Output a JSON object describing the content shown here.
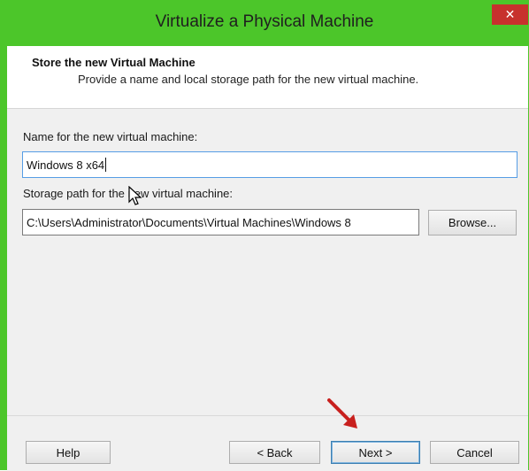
{
  "window": {
    "title": "Virtualize a Physical Machine",
    "close_label": "✕"
  },
  "header": {
    "title": "Store the new Virtual Machine",
    "subtitle": "Provide a name and local storage path for the new virtual machine."
  },
  "form": {
    "name_label": "Name for the new virtual machine:",
    "name_value": "Windows 8 x64",
    "path_label": "Storage path for the new virtual machine:",
    "path_value": "C:\\Users\\Administrator\\Documents\\Virtual Machines\\Windows 8",
    "browse_label": "Browse..."
  },
  "footer": {
    "help_label": "Help",
    "back_label": "< Back",
    "next_label": "Next >",
    "cancel_label": "Cancel"
  },
  "colors": {
    "titlebar": "#4cc62a",
    "close": "#c7312d",
    "annotation_arrow": "#c8201e"
  },
  "icons": {
    "cursor": "mouse-pointer-icon",
    "annotation": "red-arrow-icon"
  }
}
